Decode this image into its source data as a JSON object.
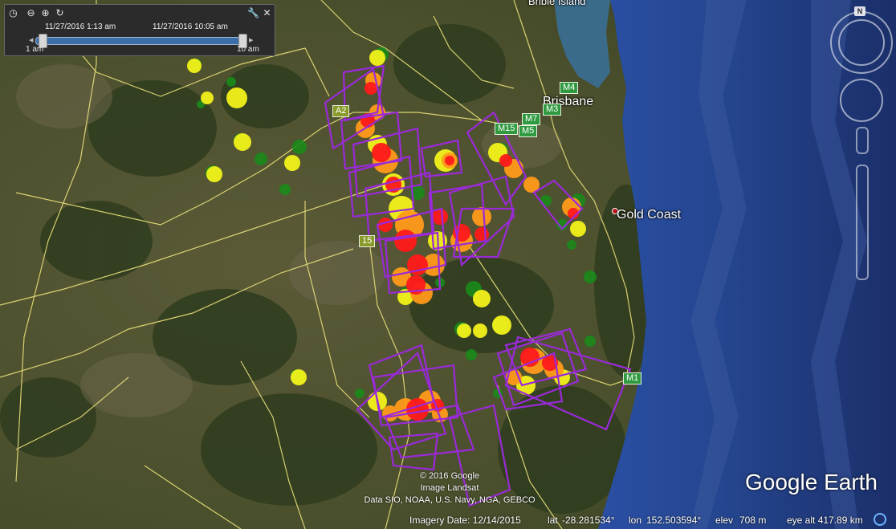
{
  "time_slider": {
    "start_datetime": "11/27/2016   1:13 am",
    "end_datetime": "11/27/2016   10:05 am",
    "start_label": "1 am",
    "end_label": "10 am",
    "range_start_fraction": 0.03,
    "range_end_fraction": 0.98
  },
  "places": {
    "bribie": "Bribie Island",
    "brisbane": "Brisbane",
    "gold_coast": "Gold Coast"
  },
  "roads": [
    "A2",
    "M4",
    "M3",
    "M7",
    "M15",
    "M5",
    "15",
    "M1"
  ],
  "attribution": {
    "line1": "© 2016 Google",
    "line2": "Image Landsat",
    "line3": "Data SIO, NOAA, U.S. Navy, NGA, GEBCO"
  },
  "status": {
    "imagery_date": "Imagery Date: 12/14/2015",
    "lat_label": "lat",
    "lat": "-28.281534°",
    "lon_label": "lon",
    "lon": "152.503594°",
    "elev_label": "elev",
    "elev": "708 m",
    "eye_alt": "eye alt 417.89 km"
  },
  "logo": "Google Earth",
  "nav": {
    "north": "N"
  },
  "colors": {
    "fire_high": "#ff1a1a",
    "fire_mid": "#ff9a1a",
    "fire_low": "#f2f21a",
    "fire_old": "#1a8a1a",
    "footprint": "#9a2ad8",
    "road": "#e8df7a",
    "ocean": "#2b4f9a"
  }
}
